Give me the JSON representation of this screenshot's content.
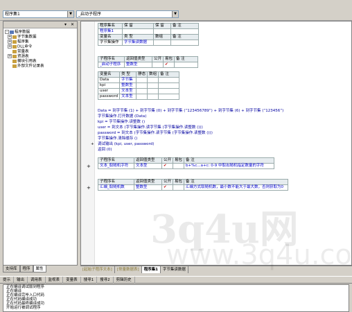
{
  "toolbar": {
    "program_set": "程序集1",
    "subprogram": "_启动子程序"
  },
  "tree": {
    "items": [
      {
        "label": "程序数据",
        "expand": "-"
      },
      {
        "label": "字节集数据",
        "expand": "+"
      },
      {
        "label": "程序集",
        "expand": "+"
      },
      {
        "label": "DLL命令",
        "expand": "+"
      },
      {
        "label": "常量表",
        "expand": ""
      },
      {
        "label": "资源表",
        "expand": "+"
      },
      {
        "label": "模块引用表",
        "expand": ""
      },
      {
        "label": "外部文件记录表",
        "expand": ""
      }
    ]
  },
  "left_tabs": [
    "支持库",
    "程序",
    "属性"
  ],
  "editor": {
    "set_table": {
      "h": [
        "程序集名",
        "保 留",
        "保 留",
        "备 注"
      ],
      "name": "程序集1",
      "var_h": [
        "变量名",
        "类 型",
        "数组",
        "备 注"
      ],
      "var_name": "字节集操作",
      "var_type": "字节集读数据"
    },
    "sub_table": {
      "h": [
        "子程序名",
        "返回值类型",
        "公开",
        "易包",
        "备 注"
      ],
      "name": "_启动子程序",
      "ret": "整数型",
      "chk": "✔"
    },
    "local_table": {
      "h": [
        "变量名",
        "类 型",
        "静态",
        "数组",
        "备 注"
      ],
      "rows": [
        {
          "name": "Data",
          "type": "字节集"
        },
        {
          "name": "kpi",
          "type": "整数型"
        },
        {
          "name": "user",
          "type": "文本型"
        },
        {
          "name": "password",
          "type": "文本型"
        }
      ]
    },
    "code": [
      "Data = 到字节集 (1) + 到字节集 (0) + 到字节集 (“123456789”) + 到字节集 (6) + 到字节集 (“123456”)",
      "字节集操作.打开数据 (Data)",
      "kpi = 字节集操作.读整数 ()",
      "user = 到文本 (字节集操作.读字节集 (字节集操作.读整数 ()))",
      "password = 到文本 (字节集操作.读字节集 (字节集操作.读整数 ()))",
      "字节集操作.清除缓存 ()",
      "调试输出 (kpi, user, password)",
      "返回 (0)"
    ],
    "sub2": {
      "h": [
        "子程序名",
        "返回值类型",
        "公开",
        "易包",
        "备 注"
      ],
      "name": "文本_取随机字符",
      "ret": "文本型",
      "chk": "✔",
      "note": "b+%c...a+c: 0-9 中取出随机指定数量的字符"
    },
    "sub3": {
      "h": [
        "子程序名",
        "返回值类型",
        "公开",
        "易包",
        "备 注"
      ],
      "name": "汇编_取随机数",
      "ret": "整数型",
      "chk": "✔",
      "note": "汇编方式取随机数，最小数不能大于最大数，否则获取为0"
    },
    "plus": "+",
    "arrow": "+"
  },
  "editor_tabs": [
    "[起始子程序文本]",
    "[常量数据表]",
    "程序集1",
    "字节集读数据"
  ],
  "bottom_tabs": [
    "提示",
    "输出",
    "调用表",
    "监视表",
    "变量表",
    "搜寻1",
    "搜寻2",
    "剪辑历史"
  ],
  "output_lines": [
    "正在编译调试版到程序",
    "正在编译",
    "正在编译完毕入口代码",
    "正在代码编译成功",
    "正在代码最终编译成功",
    "开始运行被调试程序"
  ],
  "watermark": {
    "text1": "3q4u网",
    "text2": "www.3q4u.com"
  }
}
